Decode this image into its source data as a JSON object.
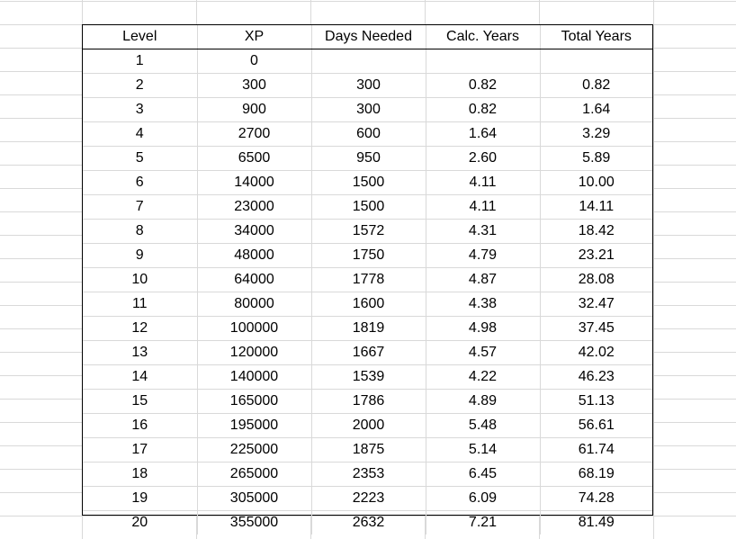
{
  "table": {
    "headers": [
      "Level",
      "XP",
      "Days Needed",
      "Calc. Years",
      "Total Years"
    ],
    "rows": [
      [
        "1",
        "0",
        "",
        "",
        ""
      ],
      [
        "2",
        "300",
        "300",
        "0.82",
        "0.82"
      ],
      [
        "3",
        "900",
        "300",
        "0.82",
        "1.64"
      ],
      [
        "4",
        "2700",
        "600",
        "1.64",
        "3.29"
      ],
      [
        "5",
        "6500",
        "950",
        "2.60",
        "5.89"
      ],
      [
        "6",
        "14000",
        "1500",
        "4.11",
        "10.00"
      ],
      [
        "7",
        "23000",
        "1500",
        "4.11",
        "14.11"
      ],
      [
        "8",
        "34000",
        "1572",
        "4.31",
        "18.42"
      ],
      [
        "9",
        "48000",
        "1750",
        "4.79",
        "23.21"
      ],
      [
        "10",
        "64000",
        "1778",
        "4.87",
        "28.08"
      ],
      [
        "11",
        "80000",
        "1600",
        "4.38",
        "32.47"
      ],
      [
        "12",
        "100000",
        "1819",
        "4.98",
        "37.45"
      ],
      [
        "13",
        "120000",
        "1667",
        "4.57",
        "42.02"
      ],
      [
        "14",
        "140000",
        "1539",
        "4.22",
        "46.23"
      ],
      [
        "15",
        "165000",
        "1786",
        "4.89",
        "51.13"
      ],
      [
        "16",
        "195000",
        "2000",
        "5.48",
        "56.61"
      ],
      [
        "17",
        "225000",
        "1875",
        "5.14",
        "61.74"
      ],
      [
        "18",
        "265000",
        "2353",
        "6.45",
        "68.19"
      ],
      [
        "19",
        "305000",
        "2223",
        "6.09",
        "74.28"
      ],
      [
        "20",
        "355000",
        "2632",
        "7.21",
        "81.49"
      ]
    ]
  }
}
